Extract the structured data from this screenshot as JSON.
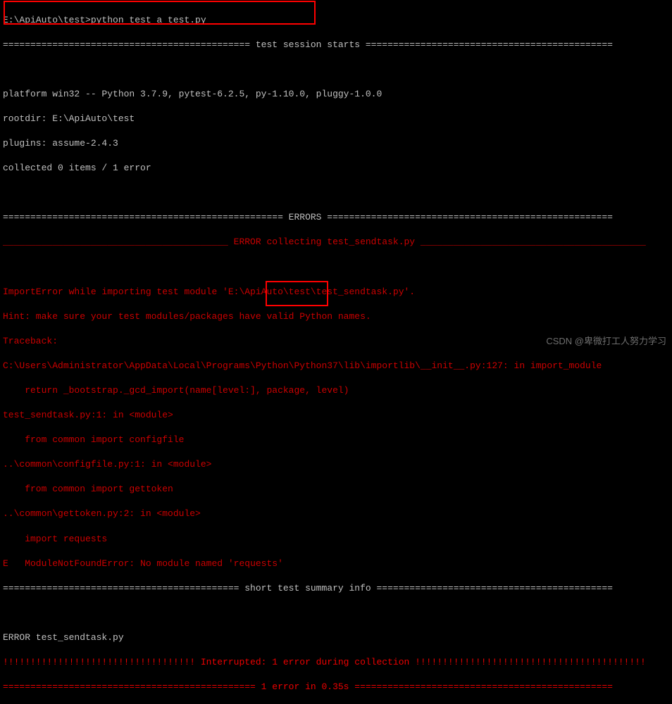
{
  "prompt": "E:\\ApiAuto\\test>python test_a_test.py",
  "session_header": "============================================= test session starts =============================================",
  "platform_line": "platform win32 -- Python 3.7.9, pytest-6.2.5, py-1.10.0, pluggy-1.0.0",
  "rootdir_line": "rootdir: E:\\ApiAuto\\test",
  "plugins_line": "plugins: assume-2.4.3",
  "collected_line": "collected 0 items / 1 error",
  "errors_divider": "=================================================== ERRORS ====================================================",
  "error_collecting": "_________________________________________ ERROR collecting test_sendtask.py _________________________________________",
  "import_error": "ImportError while importing test module 'E:\\ApiAuto\\test\\test_sendtask.py'.",
  "hint_line": "Hint: make sure your test modules/packages have valid Python names.",
  "traceback_label": "Traceback:",
  "tb_frame1": "C:\\Users\\Administrator\\AppData\\Local\\Programs\\Python\\Python37\\lib\\importlib\\__init__.py:127: in import_module",
  "tb_code1": "    return _bootstrap._gcd_import(name[level:], package, level)",
  "tb_frame2": "test_sendtask.py:1: in <module>",
  "tb_code2": "    from common import configfile",
  "tb_frame3": "..\\common\\configfile.py:1: in <module>",
  "tb_code3": "    from common import gettoken",
  "tb_frame4": "..\\common\\gettoken.py:2: in <module>",
  "tb_code4": "    import requests",
  "module_error_prefix": "E   ModuleNotFoundError: No module named ",
  "module_error_name": "'requests'",
  "short_summary": "=========================================== short test summary info ===========================================",
  "error_summary": "ERROR test_sendtask.py",
  "interrupted_line": "!!!!!!!!!!!!!!!!!!!!!!!!!!!!!!!!!!! Interrupted: 1 error during collection !!!!!!!!!!!!!!!!!!!!!!!!!!!!!!!!!!!!!!!!!!",
  "final_line": "============================================== 1 error in 0.35s ===============================================",
  "watermark": "CSDN @卑微打工人努力学习"
}
